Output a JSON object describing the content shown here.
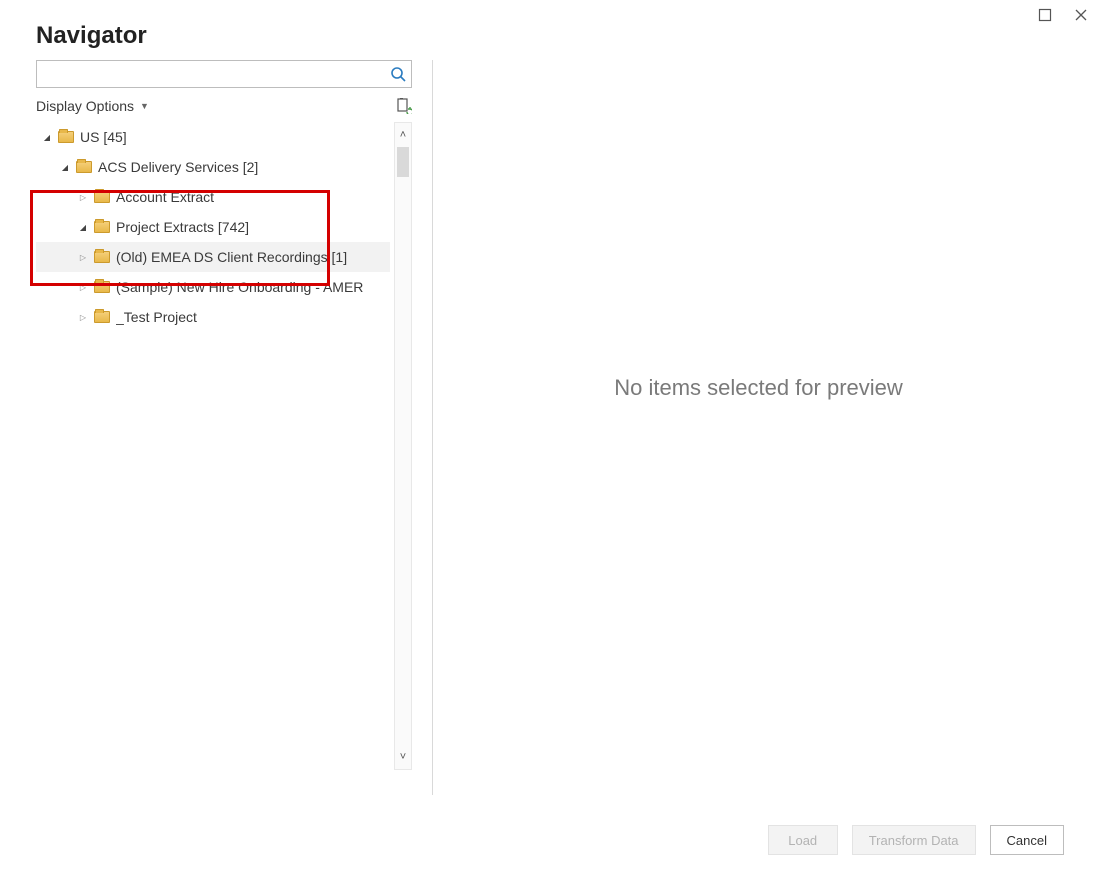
{
  "window": {
    "title": "Navigator"
  },
  "search": {
    "placeholder": ""
  },
  "display_options_label": "Display Options",
  "tree": [
    {
      "indent": 0,
      "toggle": "▲",
      "label": "US [45]",
      "selected": false
    },
    {
      "indent": 1,
      "toggle": "▲",
      "label": "ACS Delivery Services [2]",
      "selected": false
    },
    {
      "indent": 2,
      "toggle": "▷",
      "label": "Account Extract",
      "selected": false
    },
    {
      "indent": 2,
      "toggle": "▲",
      "label": "Project Extracts [742]",
      "selected": false
    },
    {
      "indent": 3,
      "toggle": "▷",
      "label": "(Old) EMEA DS Client Recordings [1]",
      "selected": true
    },
    {
      "indent": 3,
      "toggle": "▷",
      "label": "(Sample) New Hire Onboarding - AMER",
      "selected": false
    },
    {
      "indent": 3,
      "toggle": "▷",
      "label": "_Test Project",
      "selected": false
    }
  ],
  "preview": {
    "empty_message": "No items selected for preview"
  },
  "footer": {
    "load_label": "Load",
    "transform_label": "Transform Data",
    "cancel_label": "Cancel",
    "load_enabled": false,
    "transform_enabled": false,
    "cancel_enabled": true
  }
}
